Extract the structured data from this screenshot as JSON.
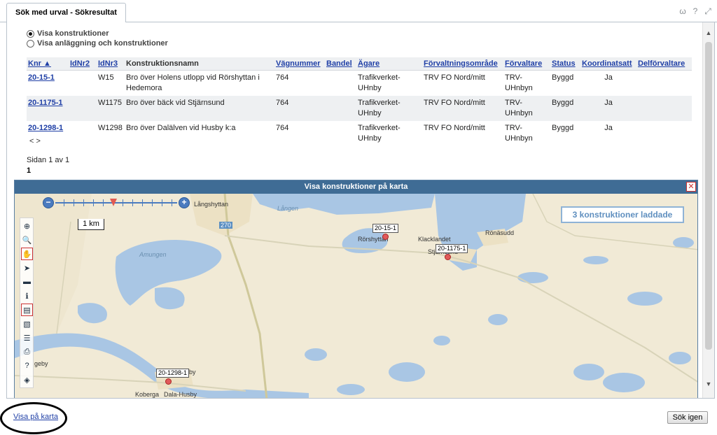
{
  "tab": {
    "label": "Sök med urval - Sökresultat"
  },
  "options": {
    "visa_konstruktioner": "Visa konstruktioner",
    "visa_anlaggning": "Visa anläggning och konstruktioner",
    "selected": "visa_konstruktioner"
  },
  "table": {
    "headers": [
      "Knr ▲",
      "IdNr2",
      "IdNr3",
      "Konstruktionsnamn",
      "Vägnummer",
      "Bandel",
      "Ägare",
      "Förvaltningsområde",
      "Förvaltare",
      "Status",
      "Koordinatsatt",
      "Delförvaltare"
    ],
    "rows": [
      {
        "knr": "20-15-1",
        "idnr2": "",
        "idnr3": "W15",
        "namn": "Bro över Holens utlopp vid Rörshyttan i Hedemora",
        "vagnummer": "764",
        "bandel": "",
        "agare": "Trafikverket-UHnby",
        "omrade": "TRV FO Nord/mitt",
        "forvaltare": "TRV-UHnbyn",
        "status": "Byggd",
        "koordinatsatt": "Ja",
        "delforvaltare": ""
      },
      {
        "knr": "20-1175-1",
        "idnr2": "",
        "idnr3": "W1175",
        "namn": "Bro över bäck vid Stjärnsund",
        "vagnummer": "764",
        "bandel": "",
        "agare": "Trafikverket-UHnby",
        "omrade": "TRV FO Nord/mitt",
        "forvaltare": "TRV-UHnbyn",
        "status": "Byggd",
        "koordinatsatt": "Ja",
        "delforvaltare": ""
      },
      {
        "knr": "20-1298-1",
        "idnr2": "",
        "idnr3": "W1298",
        "namn": "Bro över Dalälven vid Husby k:a",
        "vagnummer": "764",
        "bandel": "",
        "agare": "Trafikverket-UHnby",
        "omrade": "TRV FO Nord/mitt",
        "forvaltare": "TRV-UHnbyn",
        "status": "Byggd",
        "koordinatsatt": "Ja",
        "delforvaltare": ""
      }
    ]
  },
  "pager": {
    "arrows": "< >",
    "text": "Sidan 1 av 1",
    "current": "1"
  },
  "map": {
    "title": "Visa konstruktioner på karta",
    "loaded_badge": "3 konstruktioner laddade",
    "scale": "1 km",
    "labels": {
      "langshyttan": "Långshyttan",
      "langen": "Lången",
      "road": "270",
      "amungen": "Amungen",
      "rorshyttan": "Rörshyttan",
      "klacklandet": "Klacklandet",
      "stjarnsund": "Stjärnsund",
      "ronasudd": "Rönäsudd",
      "husby": "by",
      "geby": "geby",
      "koberga": "Koberga",
      "dalahusby": "Dala-Husby"
    },
    "points": [
      "20-15-1",
      "20-1175-1",
      "20-1298-1"
    ]
  },
  "footer": {
    "link": "Visa på karta",
    "button": "Sök igen"
  }
}
